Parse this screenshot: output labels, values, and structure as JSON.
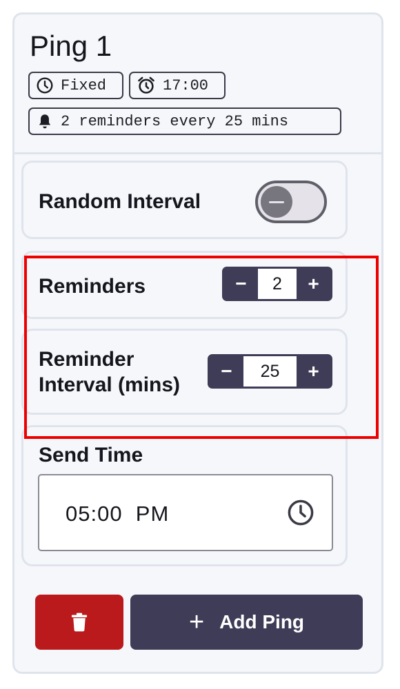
{
  "ping": {
    "title": "Ping 1",
    "badges": {
      "mode": "Fixed",
      "time": "17:00",
      "reminders_summary": "2 reminders every 25 mins"
    }
  },
  "random_interval": {
    "label": "Random Interval",
    "enabled": false
  },
  "reminders": {
    "label": "Reminders",
    "value": "2",
    "decrement_label": "−",
    "increment_label": "+"
  },
  "reminder_interval": {
    "label": "Reminder Interval (mins)",
    "value": "25",
    "decrement_label": "−",
    "increment_label": "+"
  },
  "send_time": {
    "label": "Send Time",
    "value": "05:00  PM"
  },
  "actions": {
    "add_label": "Add Ping",
    "add_icon": "+",
    "delete_icon": "trash-icon"
  },
  "colors": {
    "accent": "#3e3c56",
    "danger": "#bb1a1c",
    "highlight": "#ee0000"
  }
}
